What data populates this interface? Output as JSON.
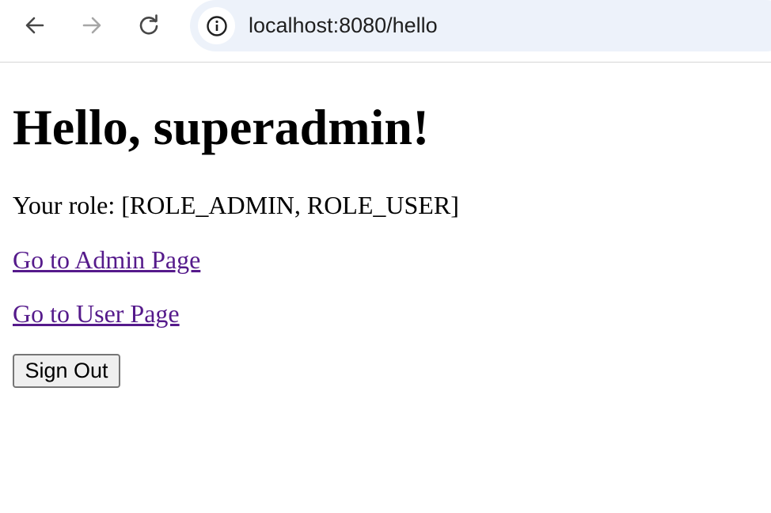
{
  "browser": {
    "back_icon": "arrow-left-icon",
    "forward_icon": "arrow-right-icon",
    "reload_icon": "reload-icon",
    "site_info_icon": "info-icon",
    "url": "localhost:8080/hello",
    "omnibox_color": "#edf2fa"
  },
  "page": {
    "heading": "Hello, superadmin!",
    "role_text": "Your role: [ROLE_ADMIN, ROLE_USER]",
    "admin_link": "Go to Admin Page",
    "user_link": "Go to User Page",
    "signout_label": "Sign Out",
    "link_color": "#551a8b"
  }
}
